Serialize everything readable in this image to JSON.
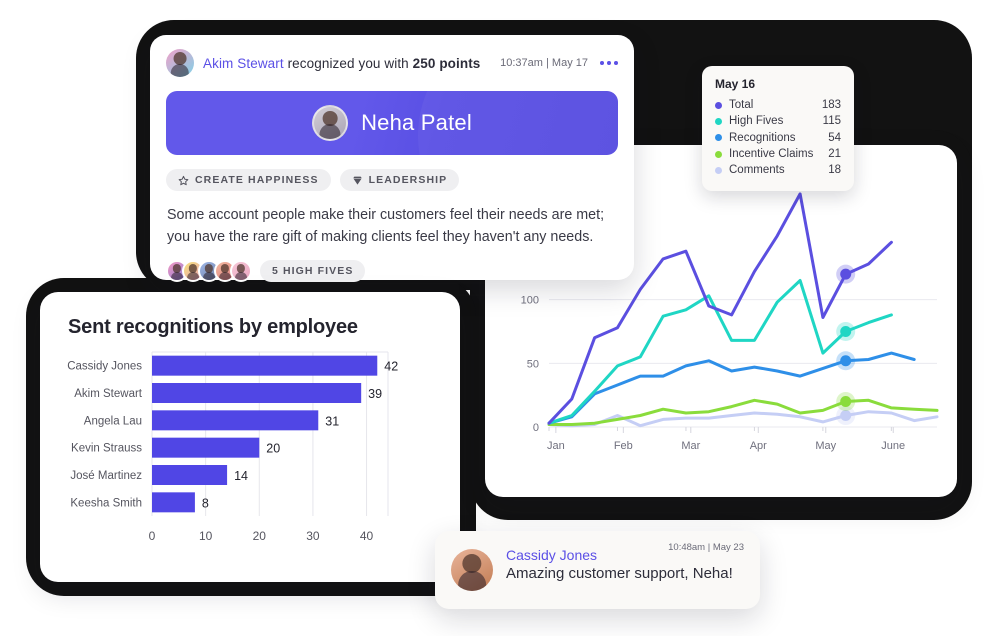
{
  "recognition": {
    "sender": "Akim Stewart",
    "headline_middle": " recognized you with ",
    "points": "250 points",
    "timestamp": "10:37am | May 17",
    "menu_icon": "more-horizontal-icon",
    "recipient": "Neha Patel",
    "tags": [
      {
        "label": "CREATE HAPPINESS",
        "icon": "star-icon"
      },
      {
        "label": "LEADERSHIP",
        "icon": "gem-icon"
      }
    ],
    "message": "Some account people make their customers feel their needs are met; you have the rare gift of making clients feel they haven't any needs.",
    "high_fives_label": "5 HIGH FIVES",
    "high_fives_count": 5,
    "banner_color": "#6258EA",
    "accent_color": "#5B50E6"
  },
  "tooltip": {
    "title": "May 16",
    "rows": [
      {
        "label": "Total",
        "value": "183",
        "color": "#5B4FE0"
      },
      {
        "label": "High Fives",
        "value": "115",
        "color": "#1FD6C4"
      },
      {
        "label": "Recognitions",
        "value": "54",
        "color": "#2E8FE8"
      },
      {
        "label": "Incentive Claims",
        "value": "21",
        "color": "#8ADC3C"
      },
      {
        "label": "Comments",
        "value": "18",
        "color": "#C5CEF5"
      }
    ]
  },
  "barchart_card": {
    "title": "Sent recognitions by employee"
  },
  "message": {
    "name": "Cassidy Jones",
    "text": "Amazing customer support, Neha!",
    "timestamp": "10:48am | May 23"
  },
  "chart_data": [
    {
      "type": "line",
      "title": "",
      "xlabel": "",
      "ylabel": "",
      "x": [
        "Jan",
        "Feb",
        "Mar",
        "Apr",
        "May",
        "June"
      ],
      "xticks": [
        "Jan",
        "Feb",
        "Mar",
        "Apr",
        "May",
        "June"
      ],
      "yticks": [
        0,
        50,
        100
      ],
      "ylim": [
        0,
        190
      ],
      "grid": true,
      "legend": "tooltip",
      "highlight_index": 13,
      "highlight_label": "May 16",
      "series": [
        {
          "name": "Total",
          "color": "#5B4FE0",
          "values": [
            3,
            22,
            70,
            78,
            108,
            132,
            138,
            95,
            88,
            122,
            150,
            183,
            86,
            120,
            128,
            145
          ]
        },
        {
          "name": "High Fives",
          "color": "#1FD6C4",
          "values": [
            3,
            9,
            28,
            48,
            55,
            87,
            92,
            103,
            68,
            68,
            98,
            115,
            58,
            75,
            82,
            88
          ]
        },
        {
          "name": "Recognitions",
          "color": "#2E8FE8",
          "values": [
            3,
            8,
            26,
            33,
            40,
            40,
            48,
            52,
            44,
            47,
            44,
            40,
            46,
            52,
            53,
            58,
            53
          ]
        },
        {
          "name": "Incentive Claims",
          "color": "#8ADC3C",
          "values": [
            2,
            2,
            3,
            6,
            9,
            14,
            11,
            12,
            16,
            21,
            18,
            11,
            13,
            20,
            21,
            15,
            14,
            13
          ]
        },
        {
          "name": "Comments",
          "color": "#C5CEF5",
          "values": [
            2,
            1,
            2,
            9,
            1,
            6,
            7,
            7,
            9,
            11,
            10,
            8,
            4,
            9,
            12,
            11,
            5,
            8
          ]
        }
      ]
    },
    {
      "type": "bar",
      "orientation": "horizontal",
      "title": "Sent recognitions by employee",
      "xlabel": "",
      "ylabel": "",
      "categories": [
        "Cassidy Jones",
        "Akim Stewart",
        "Angela Lau",
        "Kevin Strauss",
        "José Martinez",
        "Keesha Smith"
      ],
      "values": [
        42,
        39,
        31,
        20,
        14,
        8
      ],
      "xticks": [
        0,
        10,
        20,
        30,
        40
      ],
      "xlim": [
        0,
        44
      ],
      "bar_color": "#5046E5",
      "grid": true
    }
  ]
}
